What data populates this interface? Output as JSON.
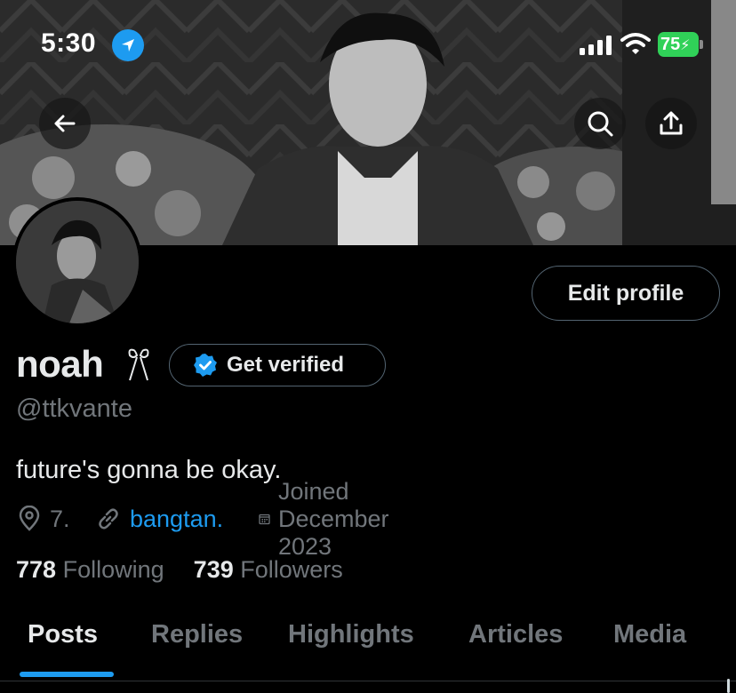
{
  "status_bar": {
    "time": "5:30",
    "battery": "75",
    "icons": [
      "location-arrow-icon",
      "cellular-signal-icon",
      "wifi-icon",
      "battery-charging-icon"
    ]
  },
  "nav": {
    "icons": [
      "arrow-left-icon",
      "search-icon",
      "share-icon"
    ]
  },
  "profile": {
    "name": "noah",
    "handle": "@ttkvante",
    "bio": "future's gonna be okay.",
    "edit_label": "Edit profile",
    "verify_label": "Get verified",
    "location": "7.",
    "website": "bangtan.",
    "joined": "Joined December 2023",
    "following_count": "778",
    "following_label": "Following",
    "followers_count": "739",
    "followers_label": "Followers"
  },
  "tabs": [
    {
      "label": "Posts",
      "active": true
    },
    {
      "label": "Replies",
      "active": false
    },
    {
      "label": "Highlights",
      "active": false
    },
    {
      "label": "Articles",
      "active": false
    },
    {
      "label": "Media",
      "active": false
    }
  ],
  "colors": {
    "accent": "#1d9bf0",
    "background": "#000000",
    "text_primary": "#e7e9ea",
    "text_secondary": "#71767b",
    "battery": "#30d158"
  }
}
